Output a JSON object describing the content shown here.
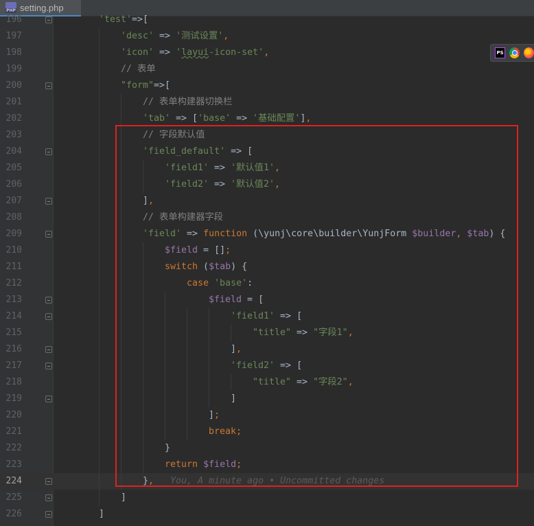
{
  "tab": {
    "filename": "setting.php",
    "icon_label": "PHP"
  },
  "browser_popup": {
    "icons": [
      "phpstorm-icon",
      "chrome-icon",
      "firefox-icon"
    ],
    "ps_label": "PS"
  },
  "annotation": {
    "color": "#e02020"
  },
  "lines": [
    {
      "num": "196",
      "indent": 2,
      "tokens": [
        [
          "s",
          "'test'"
        ],
        [
          "d",
          "=>["
        ]
      ]
    },
    {
      "num": "197",
      "indent": 3,
      "tokens": [
        [
          "s",
          "'desc'"
        ],
        [
          "d",
          " => "
        ],
        [
          "s",
          "'测试设置'"
        ],
        [
          "k",
          ","
        ]
      ]
    },
    {
      "num": "198",
      "indent": 3,
      "tokens": [
        [
          "s",
          "'icon'"
        ],
        [
          "d",
          " => "
        ],
        [
          "s",
          "'"
        ],
        [
          "sw",
          "layui"
        ],
        [
          "s",
          "-icon-set'"
        ],
        [
          "k",
          ","
        ]
      ]
    },
    {
      "num": "199",
      "indent": 3,
      "tokens": [
        [
          "c",
          "// 表单"
        ]
      ]
    },
    {
      "num": "200",
      "indent": 3,
      "tokens": [
        [
          "s",
          "\"form\""
        ],
        [
          "d",
          "=>["
        ]
      ]
    },
    {
      "num": "201",
      "indent": 4,
      "tokens": [
        [
          "c",
          "// 表单构建器切换栏"
        ]
      ]
    },
    {
      "num": "202",
      "indent": 4,
      "tokens": [
        [
          "s",
          "'tab'"
        ],
        [
          "d",
          " => ["
        ],
        [
          "s",
          "'base'"
        ],
        [
          "d",
          " => "
        ],
        [
          "s",
          "'基础配置'"
        ],
        [
          "d",
          "]"
        ],
        [
          "k",
          ","
        ]
      ]
    },
    {
      "num": "203",
      "indent": 4,
      "tokens": [
        [
          "c",
          "// 字段默认值"
        ]
      ]
    },
    {
      "num": "204",
      "indent": 4,
      "tokens": [
        [
          "s",
          "'field_default'"
        ],
        [
          "d",
          " => ["
        ]
      ]
    },
    {
      "num": "205",
      "indent": 5,
      "tokens": [
        [
          "s",
          "'field1'"
        ],
        [
          "d",
          " => "
        ],
        [
          "s",
          "'默认值1'"
        ],
        [
          "k",
          ","
        ]
      ]
    },
    {
      "num": "206",
      "indent": 5,
      "tokens": [
        [
          "s",
          "'field2'"
        ],
        [
          "d",
          " => "
        ],
        [
          "s",
          "'默认值2'"
        ],
        [
          "k",
          ","
        ]
      ]
    },
    {
      "num": "207",
      "indent": 4,
      "tokens": [
        [
          "d",
          "]"
        ],
        [
          "k",
          ","
        ]
      ]
    },
    {
      "num": "208",
      "indent": 4,
      "tokens": [
        [
          "c",
          "// 表单构建器字段"
        ]
      ]
    },
    {
      "num": "209",
      "indent": 4,
      "tokens": [
        [
          "s",
          "'field'"
        ],
        [
          "d",
          " => "
        ],
        [
          "k",
          "function"
        ],
        [
          "d",
          " (\\yunj\\core\\builder\\YunjForm "
        ],
        [
          "v",
          "$builder"
        ],
        [
          "k",
          ","
        ],
        [
          "d",
          " "
        ],
        [
          "v",
          "$tab"
        ],
        [
          "d",
          ") {"
        ]
      ]
    },
    {
      "num": "210",
      "indent": 5,
      "tokens": [
        [
          "v",
          "$field"
        ],
        [
          "d",
          " = []"
        ],
        [
          "k",
          ";"
        ]
      ]
    },
    {
      "num": "211",
      "indent": 5,
      "tokens": [
        [
          "k",
          "switch"
        ],
        [
          "d",
          " ("
        ],
        [
          "v",
          "$tab"
        ],
        [
          "d",
          ") {"
        ]
      ]
    },
    {
      "num": "212",
      "indent": 6,
      "tokens": [
        [
          "k",
          "case"
        ],
        [
          "d",
          " "
        ],
        [
          "s",
          "'base'"
        ],
        [
          "d",
          ":"
        ]
      ]
    },
    {
      "num": "213",
      "indent": 7,
      "tokens": [
        [
          "v",
          "$field"
        ],
        [
          "d",
          " = ["
        ]
      ]
    },
    {
      "num": "214",
      "indent": 8,
      "tokens": [
        [
          "s",
          "'field1'"
        ],
        [
          "d",
          " => ["
        ]
      ]
    },
    {
      "num": "215",
      "indent": 9,
      "tokens": [
        [
          "s",
          "\"title\""
        ],
        [
          "d",
          " => "
        ],
        [
          "s",
          "\"字段1\""
        ],
        [
          "k",
          ","
        ]
      ]
    },
    {
      "num": "216",
      "indent": 8,
      "tokens": [
        [
          "d",
          "]"
        ],
        [
          "k",
          ","
        ]
      ]
    },
    {
      "num": "217",
      "indent": 8,
      "tokens": [
        [
          "s",
          "'field2'"
        ],
        [
          "d",
          " => ["
        ]
      ]
    },
    {
      "num": "218",
      "indent": 9,
      "tokens": [
        [
          "s",
          "\"title\""
        ],
        [
          "d",
          " => "
        ],
        [
          "s",
          "\"字段2\""
        ],
        [
          "k",
          ","
        ]
      ]
    },
    {
      "num": "219",
      "indent": 8,
      "tokens": [
        [
          "d",
          "]"
        ]
      ]
    },
    {
      "num": "220",
      "indent": 7,
      "tokens": [
        [
          "d",
          "]"
        ],
        [
          "k",
          ";"
        ]
      ]
    },
    {
      "num": "221",
      "indent": 7,
      "tokens": [
        [
          "k",
          "break"
        ],
        [
          "k",
          ";"
        ]
      ]
    },
    {
      "num": "222",
      "indent": 5,
      "tokens": [
        [
          "d",
          "}"
        ]
      ]
    },
    {
      "num": "223",
      "indent": 5,
      "tokens": [
        [
          "k",
          "return"
        ],
        [
          "d",
          " "
        ],
        [
          "v",
          "$field"
        ],
        [
          "k",
          ";"
        ]
      ]
    },
    {
      "num": "224",
      "indent": 4,
      "current": true,
      "tokens": [
        [
          "d",
          "}"
        ],
        [
          "k",
          ","
        ],
        [
          "d",
          "   "
        ],
        [
          "h",
          "You, A minute ago • Uncommitted changes"
        ]
      ]
    },
    {
      "num": "225",
      "indent": 3,
      "tokens": [
        [
          "d",
          "]"
        ]
      ]
    },
    {
      "num": "226",
      "indent": 2,
      "tokens": [
        [
          "d",
          "]"
        ]
      ]
    }
  ]
}
